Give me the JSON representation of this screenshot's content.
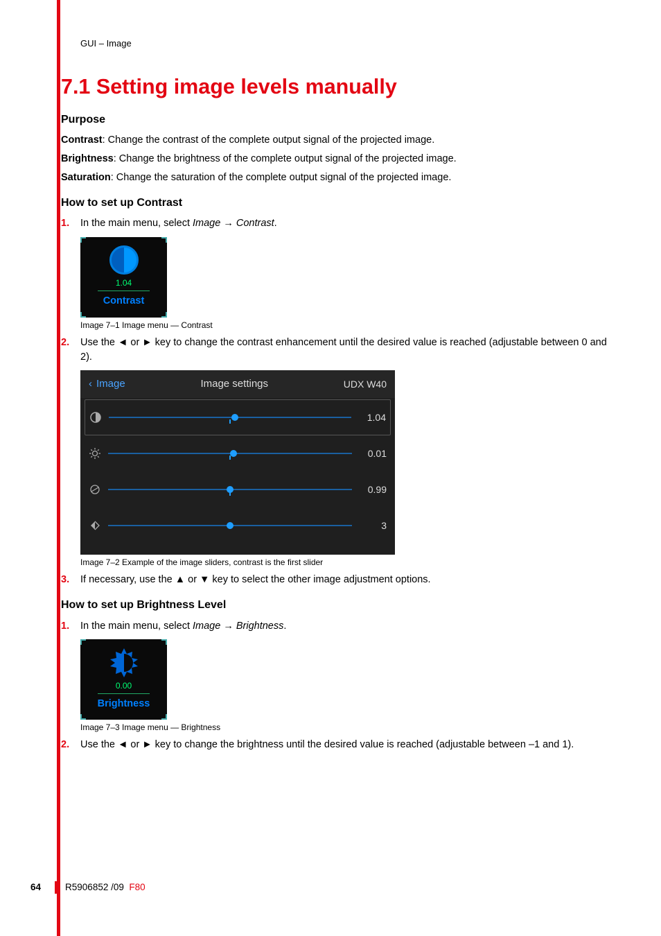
{
  "headerPath": "GUI – Image",
  "title": "7.1 Setting image levels manually",
  "purpose": {
    "heading": "Purpose",
    "items": [
      {
        "term": "Contrast",
        "desc": ": Change the contrast of the complete output signal of the projected image."
      },
      {
        "term": "Brightness",
        "desc": ": Change the brightness of the complete output signal of the projected image."
      },
      {
        "term": "Saturation",
        "desc": ": Change the saturation of the complete output signal of the projected image."
      }
    ]
  },
  "contrast": {
    "heading": "How to set up Contrast",
    "step1_prefix": "In the main menu, select ",
    "step1_path": "Image → Contrast",
    "step1_suffix": ".",
    "tile_value": "1.04",
    "tile_label": "Contrast",
    "caption1": "Image 7–1  Image menu — Contrast",
    "step2": "Use the ◄ or ► key to change the contrast enhancement until the desired value is reached (adjustable between 0 and 2).",
    "panel": {
      "back": "Image",
      "title": "Image settings",
      "model": "UDX W40",
      "sliders": [
        {
          "value": "1.04",
          "pos": 52,
          "tickPos": 50
        },
        {
          "value": "0.01",
          "pos": 51.5,
          "tickPos": 50
        },
        {
          "value": "0.99",
          "pos": 50,
          "tickPos": 50
        },
        {
          "value": "3",
          "pos": 50,
          "tickPos": null
        }
      ]
    },
    "caption2": "Image 7–2  Example of the image sliders, contrast is the first slider",
    "step3": "If necessary, use the ▲ or ▼ key to select the other image adjustment options."
  },
  "brightness": {
    "heading": "How to set up Brightness Level",
    "step1_prefix": "In the main menu, select ",
    "step1_path": "Image → Brightness",
    "step1_suffix": ".",
    "tile_value": "0.00",
    "tile_label": "Brightness",
    "caption1": "Image 7–3  Image menu — Brightness",
    "step2": "Use the ◄ or ► key to change the brightness until the desired value is reached (adjustable between –1 and 1)."
  },
  "footer": {
    "page": "64",
    "doc": "R5906852 /09",
    "model": "F80"
  }
}
